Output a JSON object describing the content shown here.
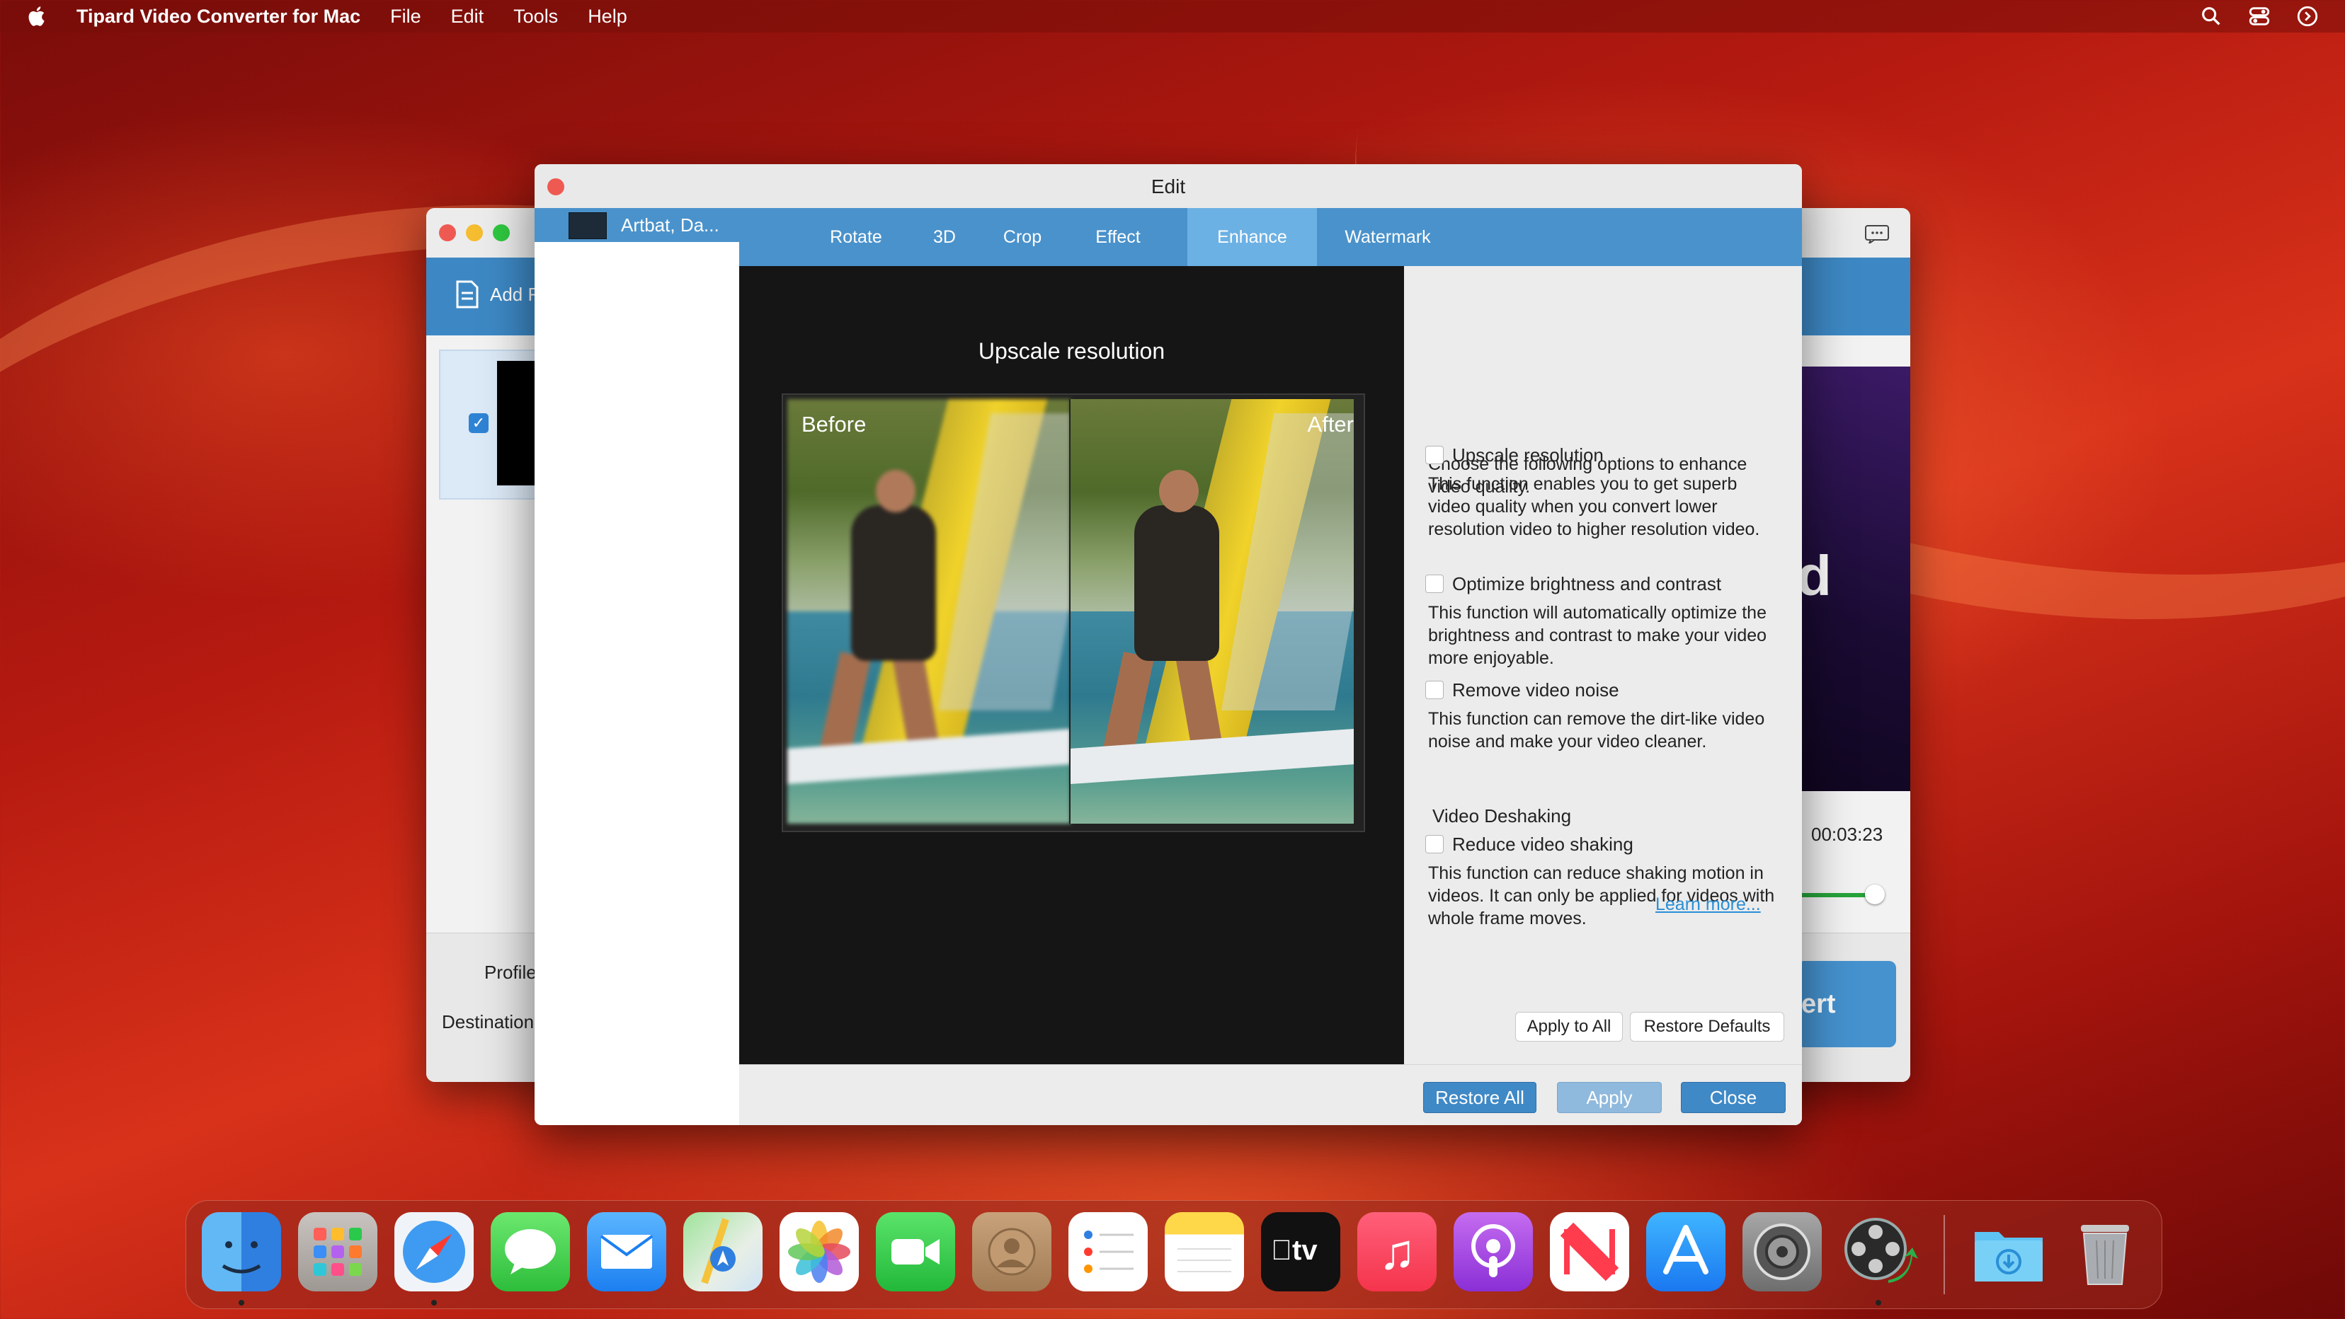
{
  "menubar": {
    "app_name": "Tipard Video Converter for Mac",
    "items": [
      "File",
      "Edit",
      "Tools",
      "Help"
    ]
  },
  "main_window": {
    "add_file_label": "Add F",
    "profile_label": "Profile",
    "destination_label": "Destination",
    "duration": "00:03:23",
    "convert_label": "ert"
  },
  "edit_dialog": {
    "title": "Edit",
    "file_name": "Artbat, Da...",
    "tabs": [
      "Rotate",
      "3D",
      "Crop",
      "Effect",
      "Enhance",
      "Watermark"
    ],
    "active_tab": "Enhance",
    "preview": {
      "title": "Upscale resolution",
      "before_label": "Before",
      "after_label": "After"
    },
    "enhance": {
      "intro": "Choose the following options to enhance video quality.",
      "options": [
        {
          "label": "Upscale resolution",
          "checked": false,
          "description": "This function enables you to get superb video quality when you convert lower resolution video to higher resolution video."
        },
        {
          "label": "Optimize brightness and contrast",
          "checked": false,
          "description": "This function will automatically optimize the brightness and contrast to make your video more enjoyable."
        },
        {
          "label": "Remove video noise",
          "checked": false,
          "description": "This function can remove the dirt-like video noise and make your video cleaner."
        }
      ],
      "deshake_section": "Video Deshaking",
      "deshake_option": {
        "label": "Reduce video shaking",
        "checked": false,
        "description": "This function can reduce shaking motion in videos. It can only be applied for videos with whole frame moves."
      },
      "learn_more": "Learn more...",
      "apply_to_all": "Apply to All",
      "restore_defaults": "Restore Defaults"
    },
    "footer": {
      "restore_all": "Restore All",
      "apply": "Apply",
      "close": "Close"
    }
  },
  "dock": {
    "apps": [
      "Finder",
      "Launchpad",
      "Safari",
      "Messages",
      "Mail",
      "Maps",
      "Photos",
      "FaceTime",
      "Contacts",
      "Reminders",
      "Notes",
      "TV",
      "Music",
      "Podcasts",
      "News",
      "App Store",
      "System Settings",
      "Tipard Video Converter",
      "Downloads",
      "Trash"
    ]
  },
  "colors": {
    "accent_blue": "#4a92cb",
    "active_tab": "#6cb1e4",
    "link": "#2a8fd6"
  }
}
